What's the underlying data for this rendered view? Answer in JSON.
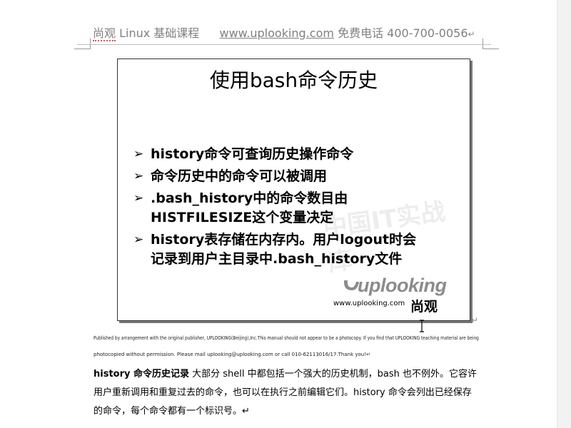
{
  "header": {
    "brand": "尚观",
    "course": "Linux 基础课程",
    "url": "www.uplooking.com",
    "phone": "免费电话 400-700-0056",
    "end_mark": "↵"
  },
  "slide": {
    "title": "使用bash命令历史",
    "bullet_symbol": "➢",
    "bullets": [
      {
        "line1": "history命令可查询历史操作命令",
        "line2": ""
      },
      {
        "line1": " 命令历史中的命令可以被调用",
        "line2": ""
      },
      {
        "line1": ".bash_history中的命令数目由",
        "line2": "HISTFILESIZE这个变量决定"
      },
      {
        "line1": "history表存储在内存内。用户logout时会",
        "line2": "记录到用户主目录中.bash_history文件"
      }
    ],
    "logo": {
      "wordmark": "uplooking",
      "url": "www.uplooking.com",
      "cn": "尚观"
    },
    "end_mark": "↵"
  },
  "fine_print": {
    "line1": "Published by arrangement with the original publisher, UPLOOKING(Beijing),Inc.This manual should not appear to be a photocopy. If you find that UPLOOKING teaching material are being",
    "line2": "photocopied without permission. Please mail uplooking@uplooking.com or call 010-62113016/17.Thank you!↵"
  },
  "body": {
    "lead": "history 命令历史记录",
    "line1_rest": "  大部分 shell 中都包括一个强大的历史机制，bash 也不例外。它容许",
    "line2": "用户重新调用和重复过去的命令，也可以在执行之前编辑它们。history 命令会列出已经保存",
    "line3": "的命令，每个命令都有一个标识号。↵"
  }
}
